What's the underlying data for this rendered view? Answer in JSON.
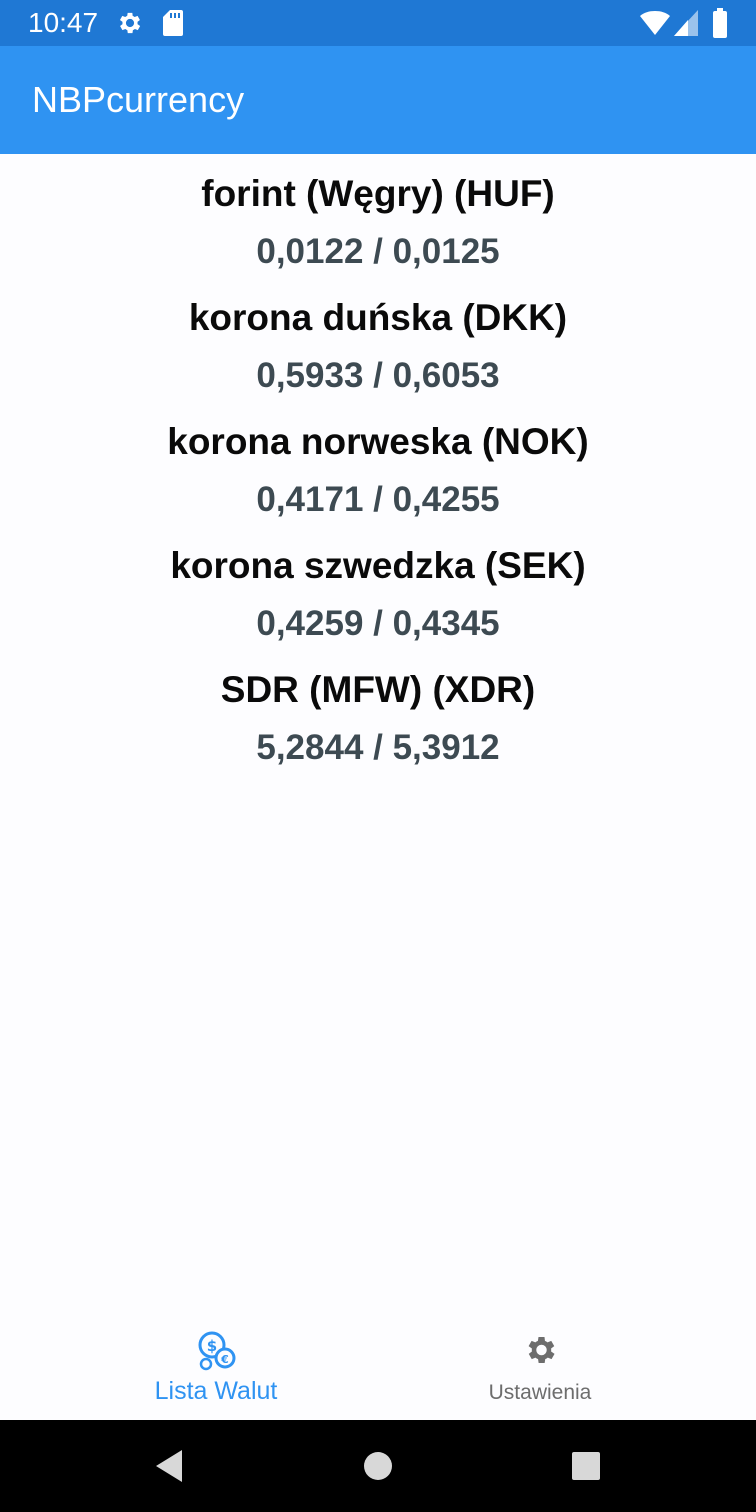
{
  "status_bar": {
    "time": "10:47",
    "icons": [
      "gear-icon",
      "sd-card-icon",
      "wifi-icon",
      "signal-icon",
      "battery-icon"
    ]
  },
  "app_bar": {
    "title": "NBPcurrency"
  },
  "currencies": [
    {
      "name": "forint (Węgry) (HUF)",
      "rates": "0,0122 / 0,0125"
    },
    {
      "name": "korona duńska (DKK)",
      "rates": "0,5933 / 0,6053"
    },
    {
      "name": "korona norweska (NOK)",
      "rates": "0,4171 / 0,4255"
    },
    {
      "name": "korona szwedzka (SEK)",
      "rates": "0,4259 / 0,4345"
    },
    {
      "name": "SDR (MFW) (XDR)",
      "rates": "5,2844 / 5,3912"
    }
  ],
  "bottom_nav": {
    "items": [
      {
        "label": "Lista Walut",
        "icon": "coins-icon",
        "active": true
      },
      {
        "label": "Ustawienia",
        "icon": "gear-icon",
        "active": false
      }
    ]
  },
  "system_nav": {
    "icons": [
      "back-icon",
      "home-icon",
      "recents-icon"
    ]
  },
  "colors": {
    "status_bar": "#1f78d4",
    "app_bar": "#2f93f2",
    "active_tab": "#2f93f2",
    "inactive_tab": "#6d6d6d",
    "rate_text": "#3d4a52"
  }
}
